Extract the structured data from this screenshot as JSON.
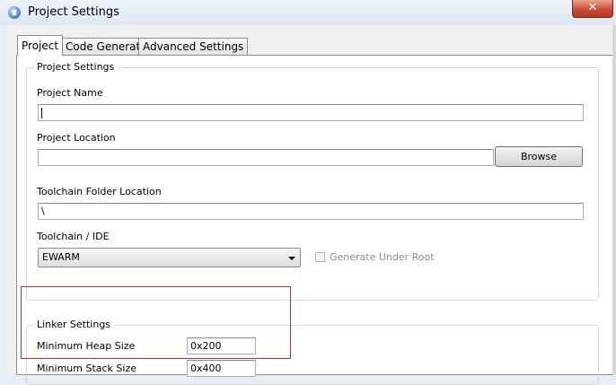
{
  "window": {
    "title": "Project Settings",
    "close_label": "✕"
  },
  "tabs": [
    {
      "label": "Project"
    },
    {
      "label": "Code Generator"
    },
    {
      "label": "Advanced Settings"
    }
  ],
  "project_settings": {
    "legend": "Project Settings",
    "project_name": {
      "label": "Project Name",
      "value": ""
    },
    "project_location": {
      "label": "Project Location",
      "value": "",
      "browse_label": "Browse"
    },
    "toolchain_folder": {
      "label": "Toolchain Folder Location",
      "value": "\\"
    },
    "toolchain_ide": {
      "label": "Toolchain / IDE",
      "value": "EWARM"
    },
    "generate_under_root": {
      "label": "Generate Under Root",
      "checked": false,
      "enabled": false
    }
  },
  "linker_settings": {
    "legend": "Linker Settings",
    "min_heap": {
      "label": "Minimum Heap Size",
      "value": "0x200"
    },
    "min_stack": {
      "label": "Minimum Stack Size",
      "value": "0x400"
    }
  },
  "colors": {
    "highlight": "#d3282e",
    "close_button": "#c74b35"
  }
}
